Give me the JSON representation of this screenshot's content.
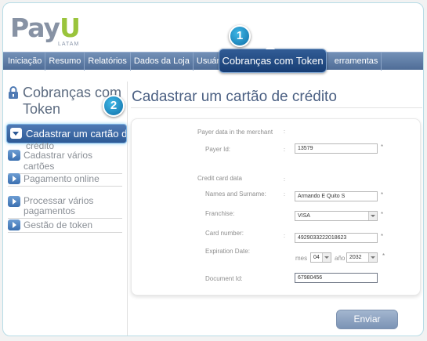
{
  "logo": {
    "text_main": "Pay",
    "text_accent": "U",
    "subtext": "LATAM"
  },
  "colors": {
    "nav": "#5c7aa6",
    "active": "#1e4a86",
    "badge": "#1e8fc9",
    "logo_accent": "#9ac43c"
  },
  "nav": {
    "items": [
      "Iniciação",
      "Resumo",
      "Relatórios",
      "Dados da Loja",
      "Usuário",
      "Ferramentas"
    ],
    "overflow_tail": "erramentas",
    "active": "Cobranças com Token"
  },
  "badges": [
    "1",
    "2"
  ],
  "sidebar": {
    "icon": "lock-icon",
    "title": "Cobranças com Token",
    "active_item": "Cadastrar um cartão de",
    "active_overflow": "crédito",
    "items": [
      "Cadastrar vários cartões",
      "Pagamento online",
      "Processar vários pagamentos",
      "Gestão de token"
    ]
  },
  "page": {
    "title": "Cadastrar um cartão de crédito"
  },
  "form": {
    "section_merchant": "Payer data in the merchant",
    "payer_id_label": "Payer Id:",
    "payer_id_value": "13579",
    "section_card": "Credit card data",
    "name_label": "Names and Surname:",
    "name_value": "Armando E Quito S",
    "franchise_label": "Franchise:",
    "franchise_value": "VISA",
    "card_number_label": "Card number:",
    "card_number_value": "4929033222018623",
    "expiration_label": "Expiration Date:",
    "month_prefix": "mes",
    "month_value": "04",
    "year_prefix": "año",
    "year_value": "2032",
    "document_label": "Document Id:",
    "document_value": "67980456",
    "required_mark": "*",
    "colon_mark": ":",
    "submit_label": "Enviar"
  }
}
